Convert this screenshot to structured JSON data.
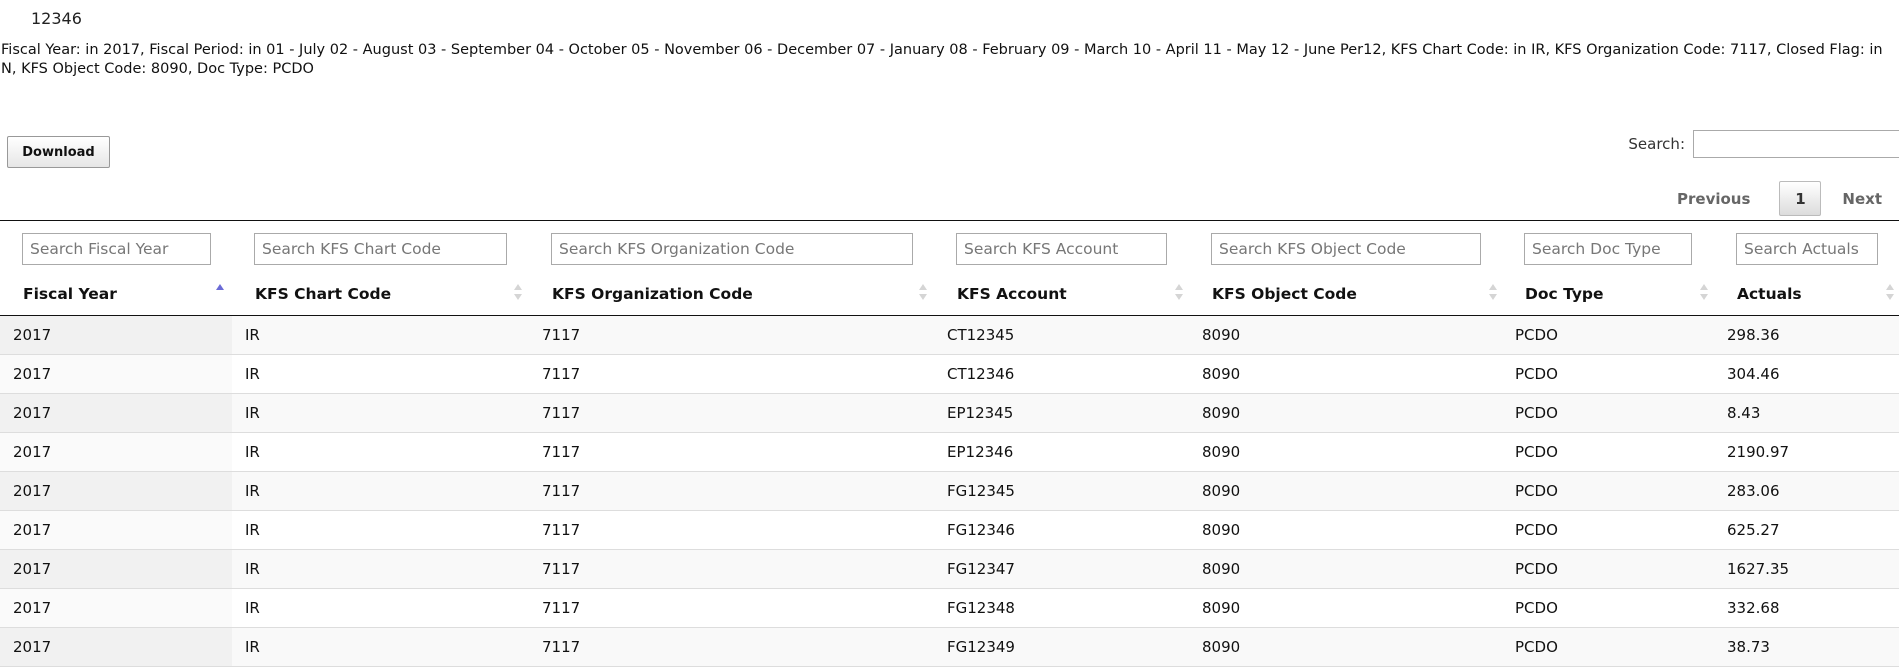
{
  "report": {
    "id_label": "12346",
    "filters_text": "Fiscal Year: in 2017, Fiscal Period: in 01 - July 02 - August 03 - September 04 - October 05 - November 06 - December 07 - January 08 - February 09 - March 10 - April 11 - May 12 - June Per12, KFS Chart Code: in IR, KFS Organization Code: 7117, Closed Flag: in N, KFS Object Code: 8090, Doc Type: PCDO"
  },
  "toolbar": {
    "download_label": "Download",
    "search_label": "Search:",
    "search_value": ""
  },
  "pager": {
    "previous_label": "Previous",
    "current_page": "1",
    "next_label": "Next"
  },
  "table": {
    "columns": [
      {
        "key": "fiscal_year",
        "label": "Fiscal Year",
        "placeholder": "Search Fiscal Year",
        "sort": "asc"
      },
      {
        "key": "chart_code",
        "label": "KFS Chart Code",
        "placeholder": "Search KFS Chart Code",
        "sort": "none"
      },
      {
        "key": "org_code",
        "label": "KFS Organization Code",
        "placeholder": "Search KFS Organization Code",
        "sort": "none"
      },
      {
        "key": "account",
        "label": "KFS Account",
        "placeholder": "Search KFS Account",
        "sort": "none"
      },
      {
        "key": "object_code",
        "label": "KFS Object Code",
        "placeholder": "Search KFS Object Code",
        "sort": "none"
      },
      {
        "key": "doc_type",
        "label": "Doc Type",
        "placeholder": "Search Doc Type",
        "sort": "none"
      },
      {
        "key": "actuals",
        "label": "Actuals",
        "placeholder": "Search Actuals",
        "sort": "none"
      }
    ],
    "rows": [
      [
        "2017",
        "IR",
        "7117",
        "CT12345",
        "8090",
        "PCDO",
        "298.36"
      ],
      [
        "2017",
        "IR",
        "7117",
        "CT12346",
        "8090",
        "PCDO",
        "304.46"
      ],
      [
        "2017",
        "IR",
        "7117",
        "EP12345",
        "8090",
        "PCDO",
        "8.43"
      ],
      [
        "2017",
        "IR",
        "7117",
        "EP12346",
        "8090",
        "PCDO",
        "2190.97"
      ],
      [
        "2017",
        "IR",
        "7117",
        "FG12345",
        "8090",
        "PCDO",
        "283.06"
      ],
      [
        "2017",
        "IR",
        "7117",
        "FG12346",
        "8090",
        "PCDO",
        "625.27"
      ],
      [
        "2017",
        "IR",
        "7117",
        "FG12347",
        "8090",
        "PCDO",
        "1627.35"
      ],
      [
        "2017",
        "IR",
        "7117",
        "FG12348",
        "8090",
        "PCDO",
        "332.68"
      ],
      [
        "2017",
        "IR",
        "7117",
        "FG12349",
        "8090",
        "PCDO",
        "38.73"
      ]
    ]
  }
}
